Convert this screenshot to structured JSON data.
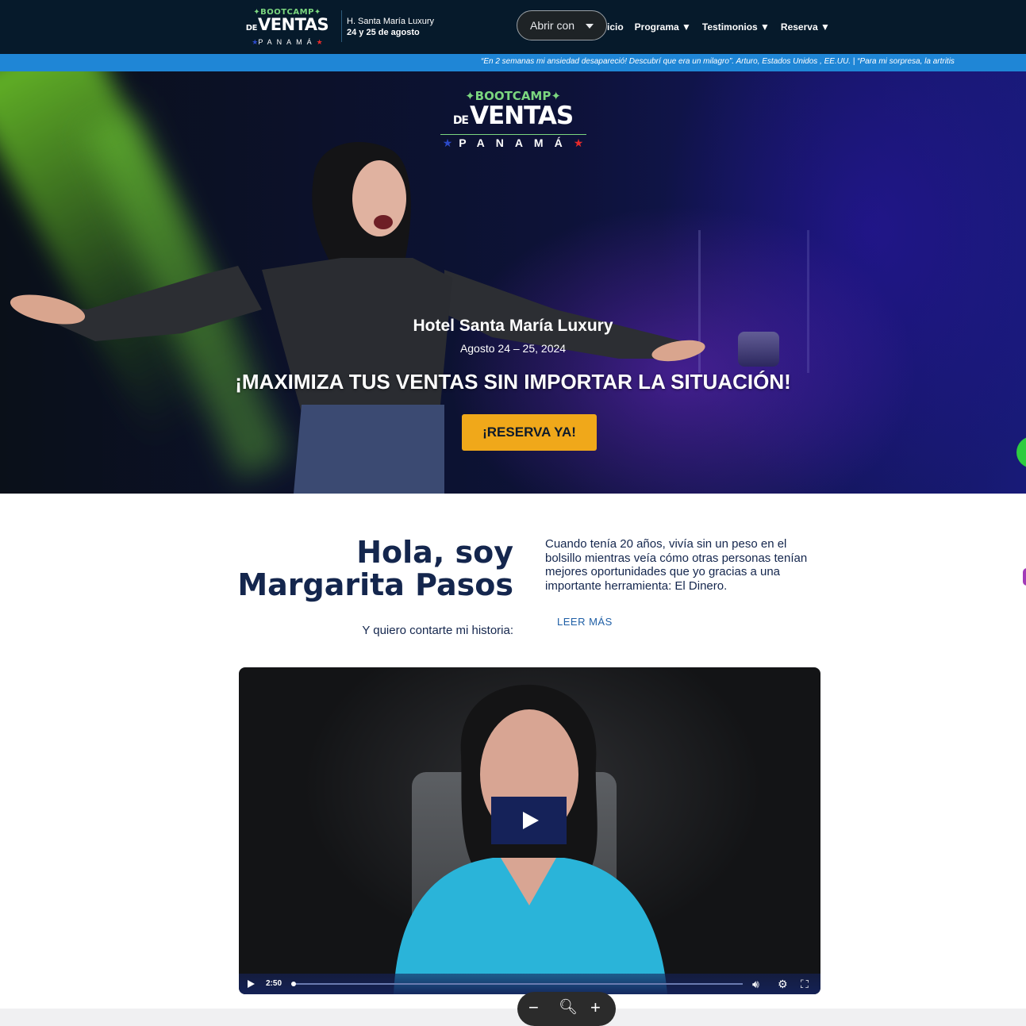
{
  "header": {
    "logo": {
      "line1": "BOOTCAMP",
      "line2_small": "DE",
      "line2_big": "VENTAS",
      "line3": "PANAMÁ"
    },
    "venue_line1": "H. Santa María Luxury",
    "venue_line2": "24 y 25 de agosto",
    "open_with_label": "Abrir con",
    "nav": {
      "inicio": "icio",
      "programa": "Programa ▼",
      "testimonios": "Testimonios ▼",
      "reserva": "Reserva ▼"
    }
  },
  "ticker": {
    "text": "“En 2 semanas mi ansiedad desapareció! Descubrí que era un milagro”. Arturo, Estados Unidos , EE.UU.   |   “Para mi sorpresa, la artritis"
  },
  "hero": {
    "logo": {
      "line1": "BOOTCAMP",
      "line2_small": "DE",
      "line2_big": "VENTAS",
      "line3": "PANAMÁ"
    },
    "venue": "Hotel Santa María Luxury",
    "date": "Agosto 24 – 25, 2024",
    "headline": "¡MAXIMIZA TUS VENTAS SIN IMPORTAR LA SITUACIÓN!",
    "cta": "¡RESERVA YA!"
  },
  "intro": {
    "heading": "Hola, soy Margarita Pasos",
    "subheading": "Y quiero contarte mi historia:",
    "story": "Cuando tenía 20 años, vivía sin un peso en el bolsillo mientras veía cómo otras personas tenían mejores oportunidades que yo gracias a una importante herramienta: El Dinero.",
    "read_more": "LEER MÁS"
  },
  "video": {
    "duration": "2:50",
    "progress": 0.0
  },
  "zoom_controls": {
    "zoom_out": "−",
    "zoom_in": "+"
  },
  "colors": {
    "nav_bg": "#061a2b",
    "ticker_bg": "#1f86d6",
    "cta_bg": "#f0a81a",
    "heading_text": "#14264d",
    "video_accent": "#152259",
    "logo_green": "#7bd67f"
  }
}
